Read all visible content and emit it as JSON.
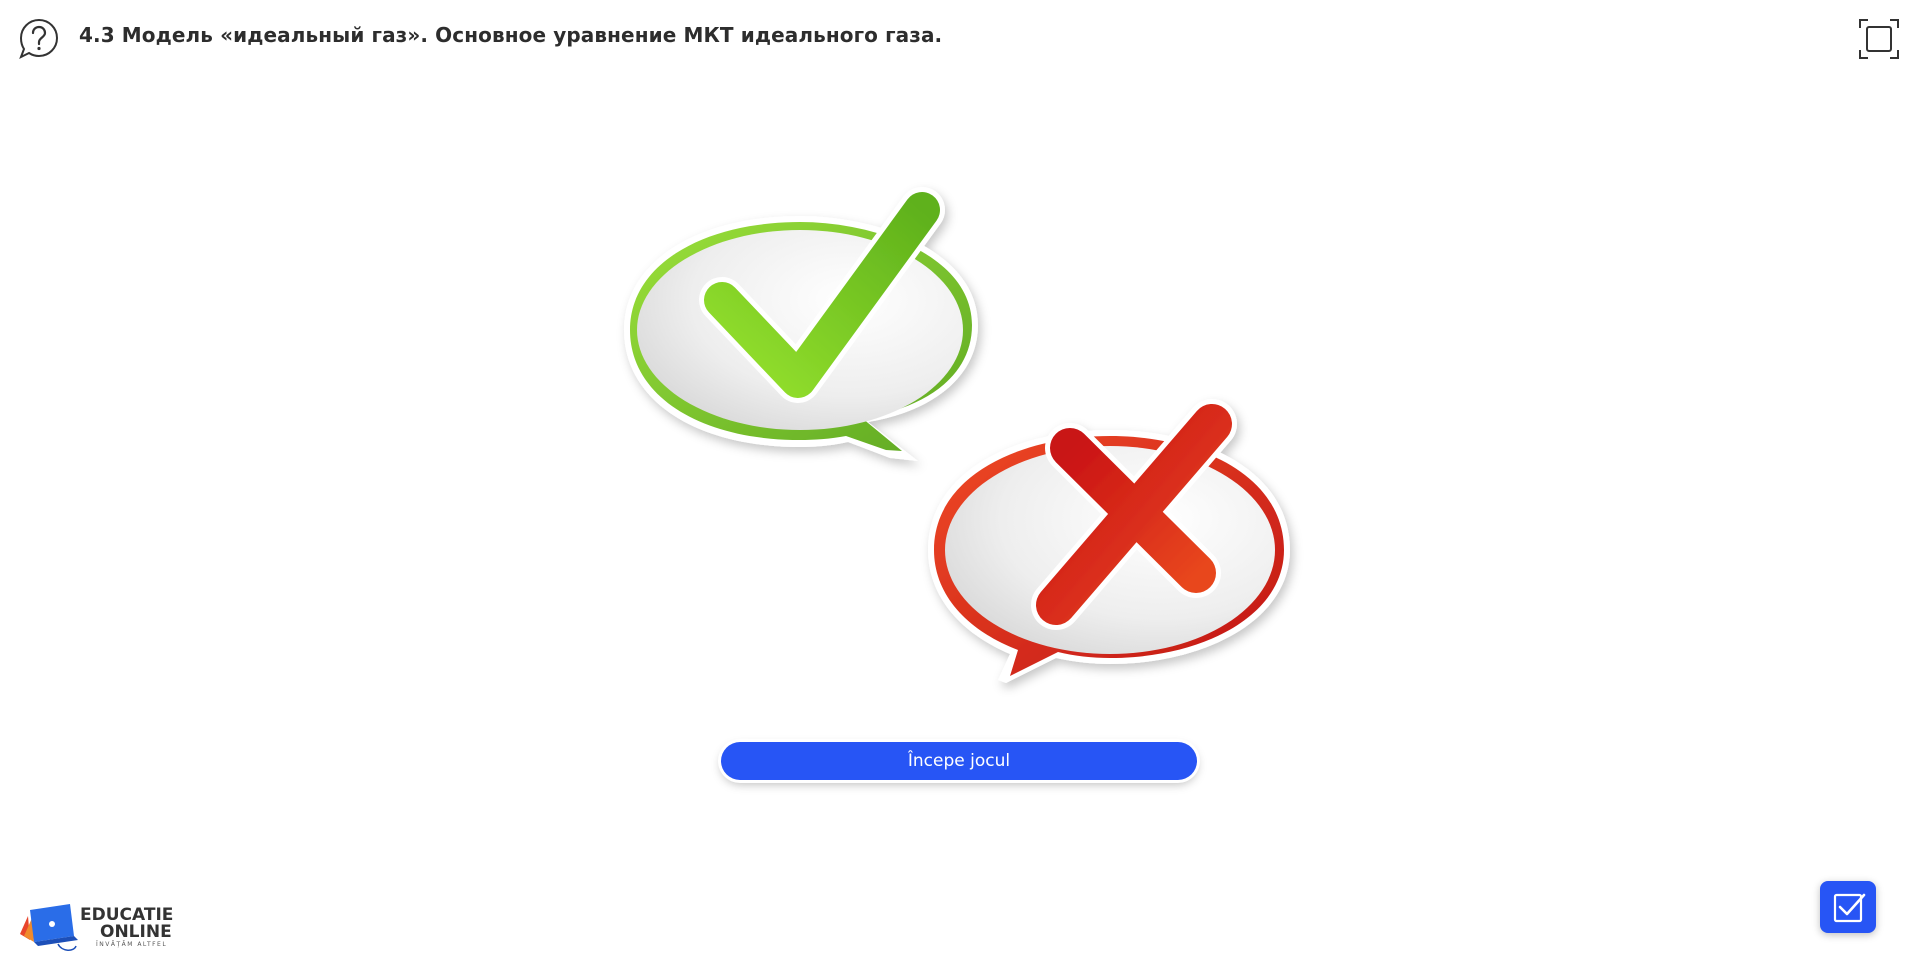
{
  "header": {
    "title": "4.3 Модель «идеальный газ». Основное уравнение МКТ идеального газа.",
    "help_icon": "help-question-icon",
    "fullscreen_icon": "fullscreen-icon"
  },
  "illustration": {
    "correct_icon": "checkmark-speech-bubble-icon",
    "wrong_icon": "cross-speech-bubble-icon"
  },
  "main": {
    "start_button_label": "Începe jocul"
  },
  "footer": {
    "brand_line_1": "EDUCATIE",
    "brand_line_2": "ONLINE",
    "brand_tagline": "ÎNVĂȚĂM ALTFEL",
    "task_icon": "checkbox-edit-icon"
  },
  "colors": {
    "accent": "#2755f5",
    "correct": "#6cbf25",
    "wrong": "#d9271c"
  }
}
